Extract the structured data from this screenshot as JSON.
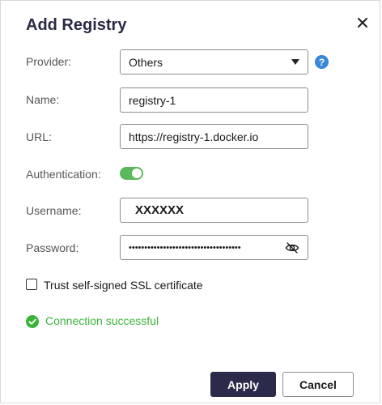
{
  "dialog": {
    "title": "Add Registry"
  },
  "form": {
    "provider": {
      "label": "Provider:",
      "value": "Others"
    },
    "name": {
      "label": "Name:",
      "value": "registry-1"
    },
    "url": {
      "label": "URL:",
      "value": "https://registry-1.docker.io"
    },
    "authentication": {
      "label": "Authentication:",
      "enabled": true
    },
    "username": {
      "label": "Username:",
      "value": "XXXXXX"
    },
    "password": {
      "label": "Password:",
      "masked_value": "••••••••••••••••••••••••••••••••••••"
    },
    "ssl": {
      "label": "Trust self-signed SSL certificate",
      "checked": false
    }
  },
  "status": {
    "text": "Connection successful",
    "color": "#3bb33b"
  },
  "buttons": {
    "apply": "Apply",
    "cancel": "Cancel"
  },
  "icons": {
    "close": "close-icon",
    "help": "help-icon",
    "dropdown": "chevron-down-icon",
    "visibility": "eye-off-icon",
    "status": "check-circle-icon"
  },
  "colors": {
    "primary": "#2c2a4a",
    "toggle_on": "#5cb85c",
    "help": "#3a86d8",
    "success": "#3bb33b"
  }
}
